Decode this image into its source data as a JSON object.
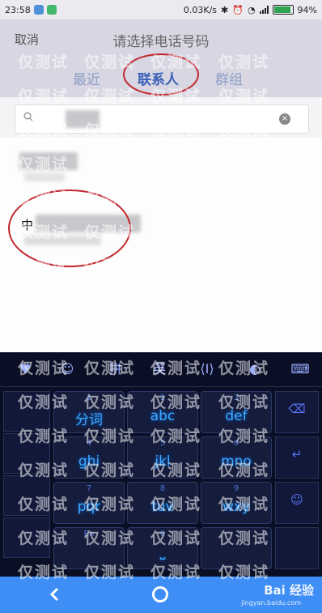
{
  "status_bar": {
    "time": "23:58",
    "network_speed": "0.03K/s",
    "battery": "94%",
    "battery_level": 0.94
  },
  "header": {
    "cancel_label": "取消",
    "title": "请选择电话号码",
    "tabs": [
      {
        "label": "最近"
      },
      {
        "label": "联系人"
      },
      {
        "label": "群组"
      }
    ]
  },
  "search": {
    "placeholder": ""
  },
  "contacts": [
    {
      "name": ""
    },
    {
      "name": "中"
    }
  ],
  "keyboard": {
    "toolbar": [
      {
        "label": "",
        "icon": "app-grid-icon"
      },
      {
        "label": "",
        "icon": "emoji-icon"
      },
      {
        "label": "拼",
        "icon": ""
      },
      {
        "label": "英",
        "icon": ""
      },
      {
        "label": "I",
        "icon": "cursor-icon"
      },
      {
        "label": "",
        "icon": "voice-icon"
      },
      {
        "label": "",
        "icon": "keyboard-icon"
      }
    ],
    "keys": [
      {
        "num": "1",
        "label": "分词"
      },
      {
        "num": "2",
        "label": "abc"
      },
      {
        "num": "3",
        "label": "def"
      },
      {
        "num": "4",
        "label": "ghi"
      },
      {
        "num": "5",
        "label": "jkl"
      },
      {
        "num": "6",
        "label": "mno"
      },
      {
        "num": "7",
        "label": "pqr"
      },
      {
        "num": "8",
        "label": "tuv"
      },
      {
        "num": "9",
        "label": "wxy"
      },
      {
        "num": "En",
        "label": ""
      },
      {
        "num": "0",
        "label": ""
      },
      {
        "num": "",
        "label": ""
      }
    ]
  },
  "watermark": {
    "text": "仅测试",
    "logo": "Bai 经验",
    "url": "jingyan.baidu.com"
  }
}
